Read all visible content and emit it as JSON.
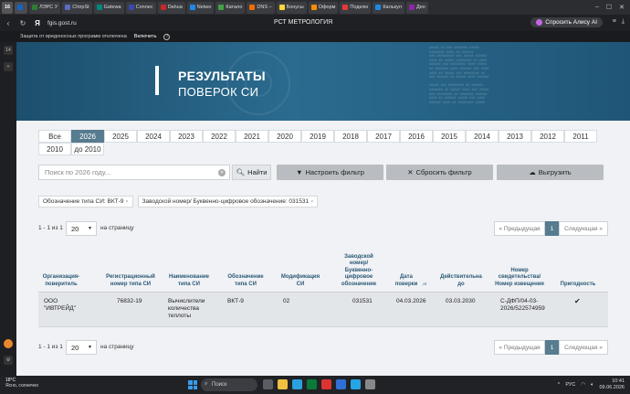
{
  "browser": {
    "tab_count": "16",
    "tabs": [
      {
        "label": "",
        "color": "#1565c0"
      },
      {
        "label": "ЛЭРС У",
        "color": "#2e7d32"
      },
      {
        "label": "ChirpSt",
        "color": "#5c6bc0"
      },
      {
        "label": "Gatewa",
        "color": "#00897b"
      },
      {
        "label": "Connec",
        "color": "#3949ab"
      },
      {
        "label": "Dahua",
        "color": "#c62828"
      },
      {
        "label": "Netwo",
        "color": "#1e88e5"
      },
      {
        "label": "Катало",
        "color": "#43a047"
      },
      {
        "label": "DNS – ",
        "color": "#ef6c00"
      },
      {
        "label": "Бонусы",
        "color": "#fdd835"
      },
      {
        "label": "Оформ",
        "color": "#fb8c00"
      },
      {
        "label": "Подклю",
        "color": "#e53935"
      },
      {
        "label": "Калькул",
        "color": "#1e88e5"
      },
      {
        "label": "Ден",
        "color": "#8e24aa"
      }
    ],
    "url": "fgis.gost.ru",
    "page_title": "РСТ МЕТРОЛОГИЯ",
    "alice_label": "Спросить Алису AI",
    "protection_text": "Защита от вредоносных программ отключена",
    "protection_button": "Включить",
    "protection_help": "?",
    "sidebar_badge": "14"
  },
  "banner": {
    "title_line1": "РЕЗУЛЬТАТЫ",
    "title_line2": "ПОВЕРОК СИ"
  },
  "years": [
    "Все",
    "2026",
    "2025",
    "2024",
    "2023",
    "2022",
    "2021",
    "2020",
    "2019",
    "2018",
    "2017",
    "2016",
    "2015",
    "2014",
    "2013",
    "2012",
    "2011",
    "2010",
    "до 2010"
  ],
  "active_year": "2026",
  "search": {
    "placeholder": "Поиск по 2026 году...",
    "find_button": "Найти",
    "configure_filter": "Настроить фильтр",
    "reset_filter": "Сбросить фильтр",
    "export": "Выгрузить"
  },
  "filters": [
    "Обозначение типа СИ: ВКТ-9",
    "Заводской номер/ Буквенно-цифровое обозначение: 031531"
  ],
  "pagination": {
    "count_text": "1 - 1 из 1",
    "per_page": "20",
    "per_page_label": "на страницу",
    "prev": "« Предыдущая",
    "current": "1",
    "next": "Следующая »"
  },
  "table": {
    "headers": [
      "Организация-поверитель",
      "Регистрационный номер типа СИ",
      "Наименование типа СИ",
      "Обозначение типа СИ",
      "Модификация СИ",
      "Заводской номер/ Буквенно-цифровое обозначение",
      "Дата поверки",
      "Действительна до",
      "Номер свидетельства/ Номер извещения",
      "Пригодность"
    ],
    "rows": [
      {
        "org": "ООО \"ИВТРЕЙД\"",
        "reg_number": "76832-19",
        "type_name": "Вычислители количества теплоты",
        "type_designation": "ВКТ-9",
        "modification": "02",
        "serial": "031531",
        "verification_date": "04.03.2026",
        "valid_until": "03.03.2030",
        "certificate": "С-ДФП/04-03-2026/522574959",
        "suitable": "✔"
      }
    ]
  },
  "taskbar": {
    "temperature": "18°C",
    "weather_text": "Ясно, солнечно",
    "search_placeholder": "Поиск",
    "language": "РУС",
    "time": "10:41",
    "date": "09.06.2026"
  }
}
